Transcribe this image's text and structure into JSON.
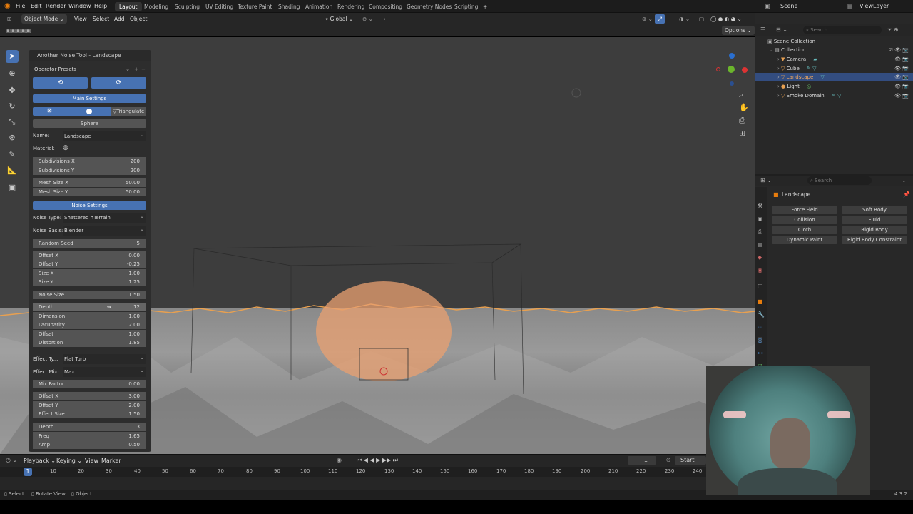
{
  "topbar": {
    "menus": [
      "File",
      "Edit",
      "Render",
      "Window",
      "Help"
    ],
    "workspaces": [
      "Layout",
      "Modeling",
      "Sculpting",
      "UV Editing",
      "Texture Paint",
      "Shading",
      "Animation",
      "Rendering",
      "Compositing",
      "Geometry Nodes",
      "Scripting"
    ],
    "add_tab": "+",
    "scene": "Scene",
    "view_layer": "ViewLayer"
  },
  "viewport_header": {
    "mode": "Object Mode",
    "menus": [
      "View",
      "Select",
      "Add",
      "Object"
    ],
    "transform": "Global",
    "options": "Options"
  },
  "operator_panel": {
    "title": "Another Noise Tool - Landscape",
    "presets": "Operator Presets",
    "main_settings": "Main Settings",
    "triangulate": "Triangulate",
    "sphere": "Sphere",
    "name_label": "Name:",
    "name_value": "Landscape",
    "material_label": "Material:",
    "subdiv_x_label": "Subdivisions X",
    "subdiv_x": "200",
    "subdiv_y_label": "Subdivisions Y",
    "subdiv_y": "200",
    "mesh_x_label": "Mesh Size X",
    "mesh_x": "50.00",
    "mesh_y_label": "Mesh Size Y",
    "mesh_y": "50.00",
    "noise_settings": "Noise Settings",
    "noise_type_label": "Noise Type:",
    "noise_type": "Shattered hTerrain",
    "noise_basis_label": "Noise Basis:",
    "noise_basis": "Blender",
    "random_seed_label": "Random Seed",
    "random_seed": "5",
    "offset_x_label": "Offset X",
    "offset_x": "0.00",
    "offset_y_label": "Offset Y",
    "offset_y": "-0.25",
    "size_x_label": "Size X",
    "size_x": "1.00",
    "size_y_label": "Size Y",
    "size_y": "1.25",
    "noise_size_label": "Noise Size",
    "noise_size": "1.50",
    "depth_label": "Depth",
    "depth": "12",
    "dimension_label": "Dimension",
    "dimension": "1.00",
    "lacunarity_label": "Lacunarity",
    "lacunarity": "2.00",
    "offset_label": "Offset",
    "offset": "1.00",
    "distortion_label": "Distortion",
    "distortion": "1.85",
    "effect_type_label": "Effect Ty...",
    "effect_type": "Flat Turb",
    "effect_mix_label": "Effect Mix:",
    "effect_mix": "Max",
    "mix_factor_label": "Mix Factor",
    "mix_factor": "0.00",
    "e_offset_x_label": "Offset X",
    "e_offset_x": "3.00",
    "e_offset_y_label": "Offset Y",
    "e_offset_y": "2.00",
    "effect_size_label": "Effect Size",
    "effect_size": "1.50",
    "e_depth_label": "Depth",
    "e_depth": "3",
    "freq_label": "Freq",
    "freq": "1.65",
    "amp_label": "Amp",
    "amp": "0.50"
  },
  "outliner": {
    "search": "Search",
    "scene_collection": "Scene Collection",
    "collection": "Collection",
    "items": [
      "Camera",
      "Cube",
      "Landscape",
      "Light",
      "Smoke Domain"
    ]
  },
  "properties": {
    "search": "Search",
    "object": "Landscape",
    "buttons": [
      "Force Field",
      "Soft Body",
      "Collision",
      "Fluid",
      "Cloth",
      "Rigid Body",
      "Dynamic Paint",
      "Rigid Body Constraint"
    ]
  },
  "timeline": {
    "menus": [
      "Playback",
      "Keying",
      "View",
      "Marker"
    ],
    "current_frame": "1",
    "start_label": "Start",
    "ticks": [
      "1",
      "10",
      "20",
      "30",
      "40",
      "50",
      "60",
      "70",
      "80",
      "90",
      "100",
      "110",
      "120",
      "130",
      "140",
      "150",
      "160",
      "170",
      "180",
      "190",
      "200",
      "210",
      "220",
      "230",
      "240"
    ]
  },
  "statusbar": {
    "select": "Select",
    "rotate": "Rotate View",
    "object": "Object",
    "version": "4.3.2"
  },
  "colors": {
    "accent": "#4772b3",
    "selected_row": "#334d80",
    "orange": "#e87d0d"
  }
}
